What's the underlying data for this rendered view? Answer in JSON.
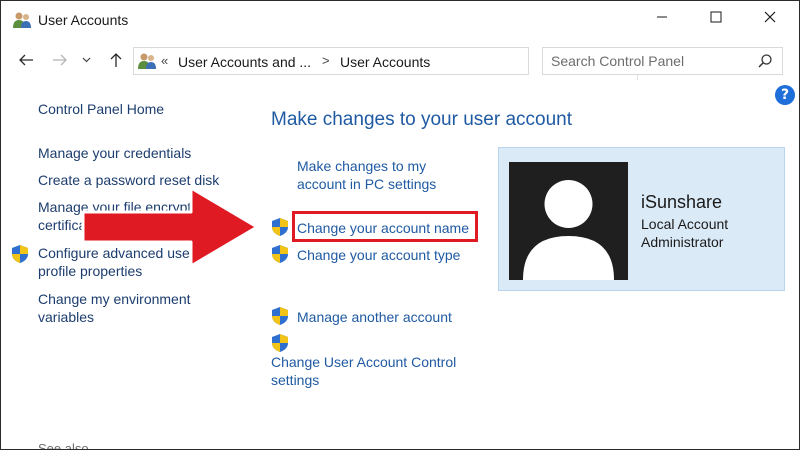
{
  "window": {
    "title": "User Accounts"
  },
  "address_bar": {
    "overflow": "«",
    "crumbs": [
      "User Accounts and ...",
      "User Accounts"
    ],
    "separator": ">"
  },
  "search": {
    "placeholder": "Search Control Panel"
  },
  "help": {
    "label": "?"
  },
  "left_pane": {
    "home": "Control Panel Home",
    "links": [
      [
        "Manage your credentials"
      ],
      [
        "Create a password reset disk"
      ],
      [
        "Manage your file encryption",
        "certificates"
      ],
      [
        "Configure advanced user",
        "profile properties"
      ],
      [
        "Change my environment",
        "variables"
      ]
    ],
    "see_also": "See also"
  },
  "main": {
    "heading": "Make changes to your user account",
    "pc_settings_link": [
      "Make changes to my",
      "account in PC settings"
    ],
    "change_name": "Change your account name",
    "change_type": "Change your account type",
    "manage_other": "Manage another account",
    "uac_settings": [
      "Change User Account Control",
      "settings"
    ]
  },
  "user": {
    "name": "iSunshare",
    "account_type": "Local Account",
    "role": "Administrator"
  },
  "colors": {
    "link": "#1f5aa3",
    "highlight": "#e01a22",
    "card_bg": "#dbeaf7"
  }
}
